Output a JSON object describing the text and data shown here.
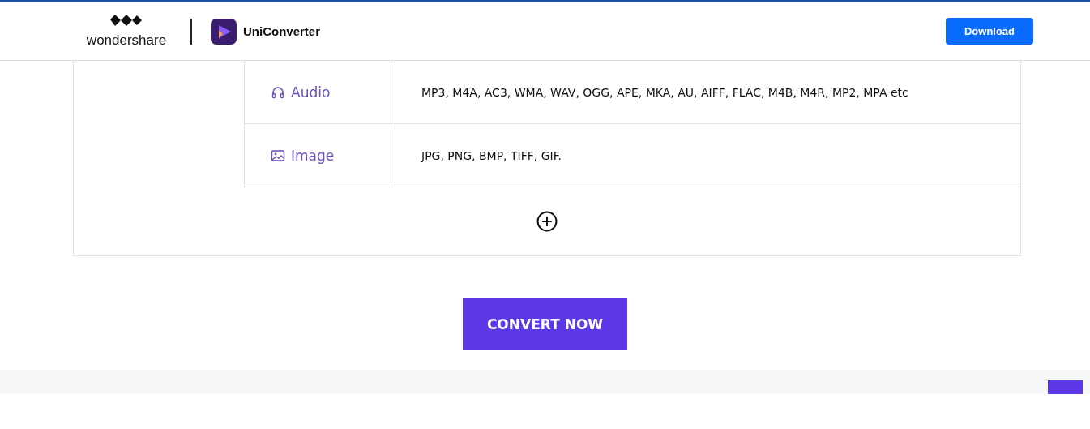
{
  "header": {
    "brand": "wondershare",
    "product": "UniConverter",
    "download_button": "Download"
  },
  "formats": [
    {
      "kind": "audio",
      "label": "Audio",
      "formats": "MP3, M4A, AC3, WMA, WAV, OGG, APE, MKA, AU, AIFF, FLAC, M4B, M4R, MP2, MPA etc"
    },
    {
      "kind": "image",
      "label": "Image",
      "formats": "JPG, PNG, BMP, TIFF, GIF."
    }
  ],
  "convert_button": "CONVERT NOW"
}
